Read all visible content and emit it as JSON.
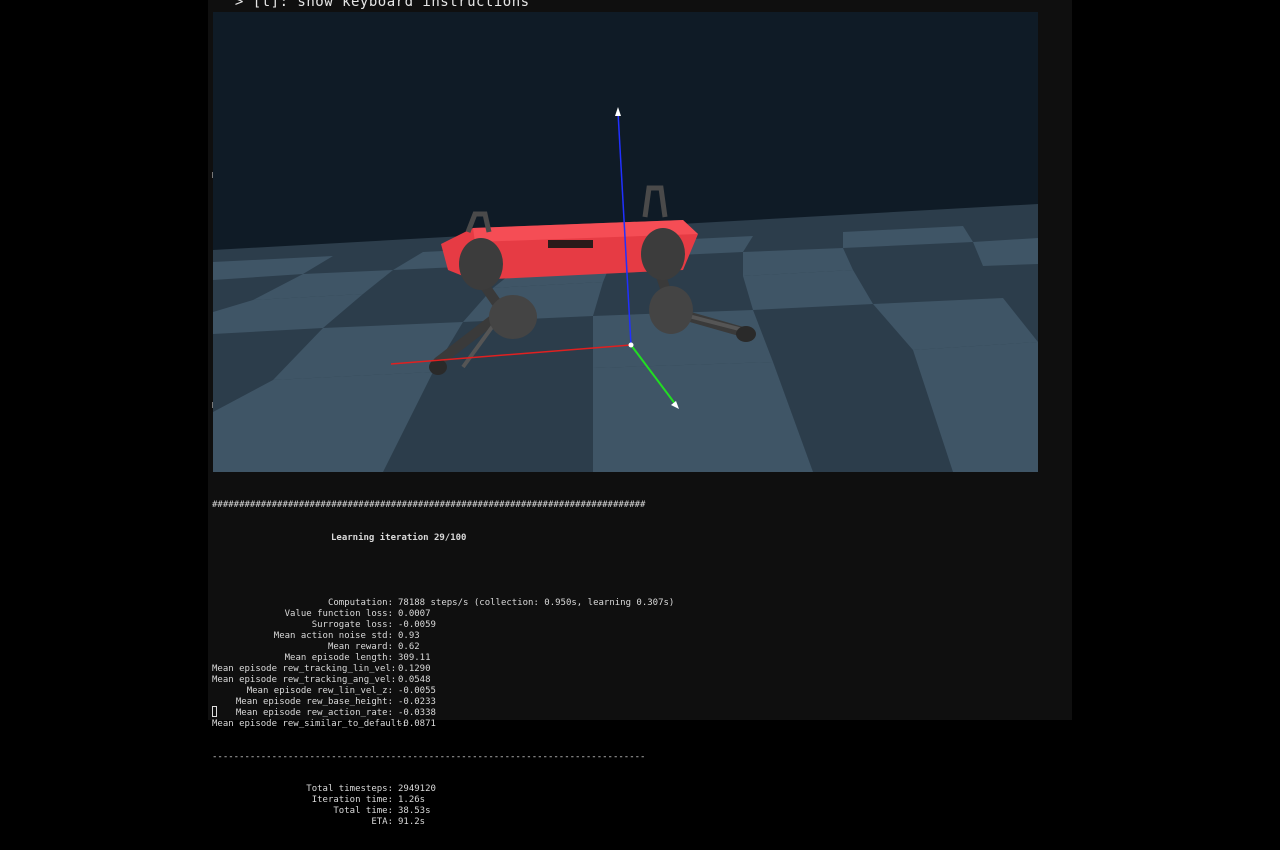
{
  "viewer": {
    "instructions_text": " > [t]: show keyboard instructions"
  },
  "terminal": {
    "separator_hash": "################################################################################",
    "title": "Learning iteration 29/100",
    "stats": [
      {
        "key": "Computation:",
        "value": "78188 steps/s (collection: 0.950s, learning 0.307s)"
      },
      {
        "key": "Value function loss:",
        "value": "0.0007"
      },
      {
        "key": "Surrogate loss:",
        "value": "-0.0059"
      },
      {
        "key": "Mean action noise std:",
        "value": "0.93"
      },
      {
        "key": "Mean reward:",
        "value": "0.62"
      },
      {
        "key": "Mean episode length:",
        "value": "309.11"
      },
      {
        "key": "Mean episode rew_tracking_lin_vel:",
        "value": "0.1290"
      },
      {
        "key": "Mean episode rew_tracking_ang_vel:",
        "value": "0.0548"
      },
      {
        "key": "Mean episode rew_lin_vel_z:",
        "value": "-0.0055"
      },
      {
        "key": "Mean episode rew_base_height:",
        "value": "-0.0233"
      },
      {
        "key": "Mean episode rew_action_rate:",
        "value": "-0.0338"
      },
      {
        "key": "Mean episode rew_similar_to_default:",
        "value": "-0.0871"
      }
    ],
    "separator_dash": "--------------------------------------------------------------------------------",
    "totals": [
      {
        "key": "Total timesteps:",
        "value": "2949120"
      },
      {
        "key": "Iteration time:",
        "value": "1.26s"
      },
      {
        "key": "Total time:",
        "value": "38.53s"
      },
      {
        "key": "ETA:",
        "value": "91.2s"
      }
    ]
  },
  "colors": {
    "sky": "#0f1b26",
    "floor_light": "#3f5566",
    "floor_dark": "#2c3d4b",
    "robot_body": "#e63b44",
    "robot_legs": "#3a3a3a",
    "axis_x": "#e02020",
    "axis_y": "#22dd22",
    "axis_z": "#2030ff"
  }
}
